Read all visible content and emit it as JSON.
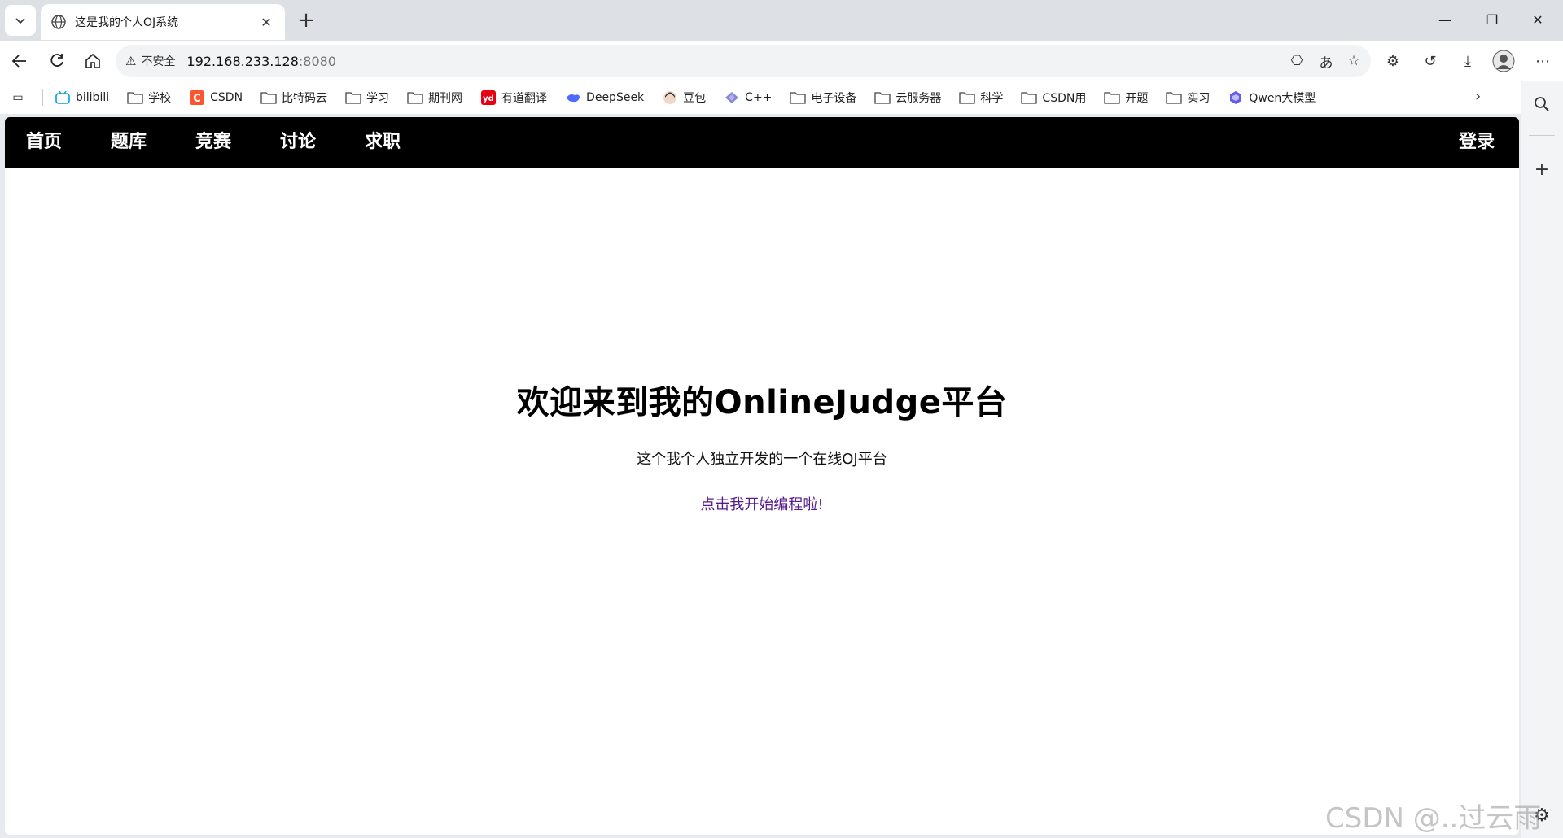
{
  "browser": {
    "tab_title": "这是我的个人OJ系统",
    "address": {
      "security_label": "不安全",
      "host": "192.168.233.128",
      "port": ":8080"
    }
  },
  "bookmarks": [
    {
      "label": "bilibili",
      "icon": "bilibili-icon"
    },
    {
      "label": "学校",
      "icon": "folder-icon"
    },
    {
      "label": "CSDN",
      "icon": "csdn-icon"
    },
    {
      "label": "比特码云",
      "icon": "folder-icon"
    },
    {
      "label": "学习",
      "icon": "folder-icon"
    },
    {
      "label": "期刊网",
      "icon": "folder-icon"
    },
    {
      "label": "有道翻译",
      "icon": "youdao-icon"
    },
    {
      "label": "DeepSeek",
      "icon": "deepseek-icon"
    },
    {
      "label": "豆包",
      "icon": "doubao-icon"
    },
    {
      "label": "C++",
      "icon": "cpp-icon"
    },
    {
      "label": "电子设备",
      "icon": "folder-icon"
    },
    {
      "label": "云服务器",
      "icon": "folder-icon"
    },
    {
      "label": "科学",
      "icon": "folder-icon"
    },
    {
      "label": "CSDN用",
      "icon": "folder-icon"
    },
    {
      "label": "开题",
      "icon": "folder-icon"
    },
    {
      "label": "实习",
      "icon": "folder-icon"
    },
    {
      "label": "Qwen大模型",
      "icon": "qwen-icon"
    }
  ],
  "site": {
    "nav": {
      "home": "首页",
      "problems": "题库",
      "contest": "竞赛",
      "discuss": "讨论",
      "jobs": "求职",
      "login": "登录"
    },
    "hero": {
      "title": "欢迎来到我的OnlineJudge平台",
      "subtitle": "这个我个人独立开发的一个在线OJ平台",
      "cta": "点击我开始编程啦!"
    }
  },
  "watermark": "CSDN @..过云雨",
  "colors": {
    "nav_bg": "#000000",
    "link_visited": "#551a8b",
    "csdn_brand": "#fc5531",
    "youdao_brand": "#e60012"
  }
}
